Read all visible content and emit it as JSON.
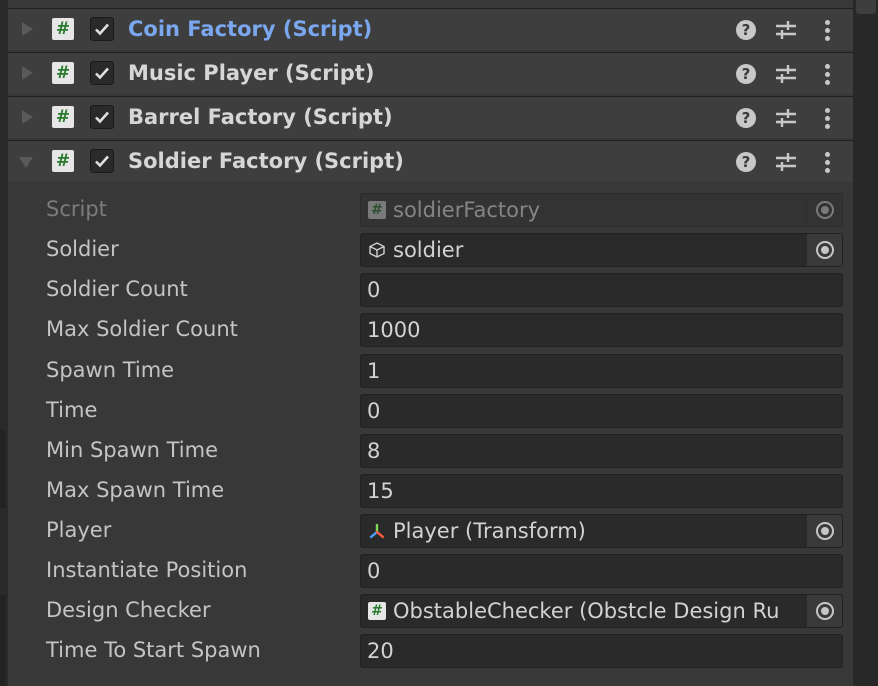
{
  "components": [
    {
      "title": "Coin Factory (Script)",
      "expanded": false,
      "selected": true
    },
    {
      "title": "Music Player (Script)",
      "expanded": false,
      "selected": false
    },
    {
      "title": "Barrel Factory (Script)",
      "expanded": false,
      "selected": false
    },
    {
      "title": "Soldier Factory (Script)",
      "expanded": true,
      "selected": false
    }
  ],
  "header_icons": {
    "help": "?"
  },
  "script_icon_glyph": "#",
  "properties": [
    {
      "label": "Script",
      "value": "soldierFactory",
      "kind": "object",
      "icon": "script-icon",
      "disabled": true
    },
    {
      "label": "Soldier",
      "value": "soldier",
      "kind": "object",
      "icon": "prefab-cube-icon",
      "disabled": false
    },
    {
      "label": "Soldier Count",
      "value": "0",
      "kind": "number"
    },
    {
      "label": "Max Soldier Count",
      "value": "1000",
      "kind": "number"
    },
    {
      "label": "Spawn Time",
      "value": "1",
      "kind": "number"
    },
    {
      "label": "Time",
      "value": "0",
      "kind": "number"
    },
    {
      "label": "Min Spawn Time",
      "value": "8",
      "kind": "number"
    },
    {
      "label": "Max Spawn Time",
      "value": "15",
      "kind": "number"
    },
    {
      "label": "Player",
      "value": "Player (Transform)",
      "kind": "object",
      "icon": "transform-icon",
      "disabled": false
    },
    {
      "label": "Instantiate Position",
      "value": "0",
      "kind": "number"
    },
    {
      "label": "Design Checker",
      "value": "ObstableChecker (Obstcle Design Ru",
      "kind": "object",
      "icon": "script-icon",
      "disabled": false
    },
    {
      "label": "Time To Start Spawn",
      "value": "20",
      "kind": "number"
    }
  ],
  "colors": {
    "selected_title": "#7aa7ee",
    "background": "#383838",
    "field": "#2a2a2a"
  }
}
